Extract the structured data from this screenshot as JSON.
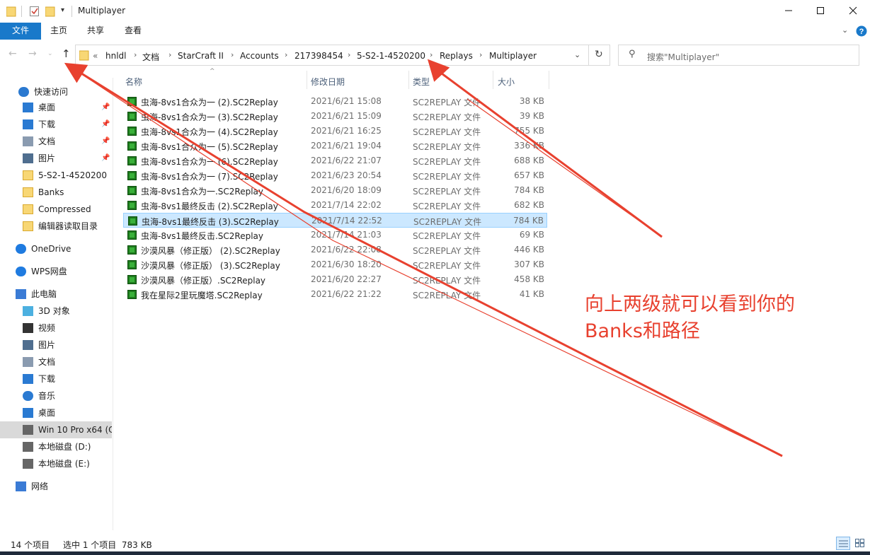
{
  "window": {
    "title": "Multiplayer"
  },
  "ribbon": {
    "tabs": [
      "文件",
      "主页",
      "共享",
      "查看"
    ]
  },
  "address": {
    "overflow": "«",
    "crumbs": [
      "hnldl",
      "文档",
      "StarCraft II",
      "Accounts",
      "217398454",
      "5-S2-1-4520200",
      "Replays",
      "Multiplayer"
    ]
  },
  "search": {
    "placeholder": "搜索\"Multiplayer\""
  },
  "nav": {
    "quick_access": "快速访问",
    "items": [
      {
        "label": "快速访问",
        "icon": "star-icon"
      },
      {
        "label": "桌面",
        "icon": "desktop-icon",
        "pinned": true
      },
      {
        "label": "下载",
        "icon": "download-icon",
        "pinned": true
      },
      {
        "label": "文档",
        "icon": "document-icon",
        "pinned": true
      },
      {
        "label": "图片",
        "icon": "picture-icon",
        "pinned": true
      },
      {
        "label": "5-S2-1-4520200",
        "icon": "folder-icon"
      },
      {
        "label": "Banks",
        "icon": "folder-icon"
      },
      {
        "label": "Compressed",
        "icon": "folder-icon"
      },
      {
        "label": "编辑器读取目录",
        "icon": "folder-icon"
      },
      {
        "label": "OneDrive",
        "icon": "cloud-icon"
      },
      {
        "label": "WPS网盘",
        "icon": "cloud-icon"
      },
      {
        "label": "此电脑",
        "icon": "computer-icon"
      },
      {
        "label": "3D 对象",
        "icon": "cube-icon"
      },
      {
        "label": "视频",
        "icon": "video-icon"
      },
      {
        "label": "图片",
        "icon": "picture-icon"
      },
      {
        "label": "文档",
        "icon": "document-icon"
      },
      {
        "label": "下载",
        "icon": "download-icon"
      },
      {
        "label": "音乐",
        "icon": "music-icon"
      },
      {
        "label": "桌面",
        "icon": "desktop-icon"
      },
      {
        "label": "Win 10 Pro x64 (C",
        "icon": "drive-icon"
      },
      {
        "label": "本地磁盘 (D:)",
        "icon": "drive-icon"
      },
      {
        "label": "本地磁盘 (E:)",
        "icon": "drive-icon"
      },
      {
        "label": "网络",
        "icon": "network-icon"
      }
    ]
  },
  "columns": {
    "name": "名称",
    "date": "修改日期",
    "type": "类型",
    "size": "大小"
  },
  "files": [
    {
      "name": "虫海-8vs1合众为一 (2).SC2Replay",
      "date": "2021/6/21 15:08",
      "type": "SC2REPLAY 文件",
      "size": "38 KB"
    },
    {
      "name": "虫海-8vs1合众为一 (3).SC2Replay",
      "date": "2021/6/21 15:09",
      "type": "SC2REPLAY 文件",
      "size": "39 KB"
    },
    {
      "name": "虫海-8vs1合众为一 (4).SC2Replay",
      "date": "2021/6/21 16:25",
      "type": "SC2REPLAY 文件",
      "size": "755 KB"
    },
    {
      "name": "虫海-8vs1合众为一 (5).SC2Replay",
      "date": "2021/6/21 19:04",
      "type": "SC2REPLAY 文件",
      "size": "336 KB"
    },
    {
      "name": "虫海-8vs1合众为一 (6).SC2Replay",
      "date": "2021/6/22 21:07",
      "type": "SC2REPLAY 文件",
      "size": "688 KB"
    },
    {
      "name": "虫海-8vs1合众为一 (7).SC2Replay",
      "date": "2021/6/23 20:54",
      "type": "SC2REPLAY 文件",
      "size": "657 KB"
    },
    {
      "name": "虫海-8vs1合众为一.SC2Replay",
      "date": "2021/6/20 18:09",
      "type": "SC2REPLAY 文件",
      "size": "784 KB"
    },
    {
      "name": "虫海-8vs1最终反击 (2).SC2Replay",
      "date": "2021/7/14 22:02",
      "type": "SC2REPLAY 文件",
      "size": "682 KB"
    },
    {
      "name": "虫海-8vs1最终反击 (3).SC2Replay",
      "date": "2021/7/14 22:52",
      "type": "SC2REPLAY 文件",
      "size": "784 KB",
      "selected": true
    },
    {
      "name": "虫海-8vs1最终反击.SC2Replay",
      "date": "2021/7/14 21:03",
      "type": "SC2REPLAY 文件",
      "size": "69 KB"
    },
    {
      "name": "沙漠风暴（修正版） (2).SC2Replay",
      "date": "2021/6/22 22:08",
      "type": "SC2REPLAY 文件",
      "size": "446 KB"
    },
    {
      "name": "沙漠风暴（修正版） (3).SC2Replay",
      "date": "2021/6/30 18:20",
      "type": "SC2REPLAY 文件",
      "size": "307 KB"
    },
    {
      "name": "沙漠风暴（修正版）.SC2Replay",
      "date": "2021/6/20 22:27",
      "type": "SC2REPLAY 文件",
      "size": "458 KB"
    },
    {
      "name": "我在星际2里玩魔塔.SC2Replay",
      "date": "2021/6/22 21:22",
      "type": "SC2REPLAY 文件",
      "size": "41 KB"
    }
  ],
  "status": {
    "count": "14 个项目",
    "selection": "选中 1 个项目  783 KB"
  },
  "annotation": {
    "line1": "向上两级就可以看到你的",
    "line2": "Banks和路径"
  },
  "colors": {
    "accent": "#1979ca",
    "annotation": "#e8412f",
    "selection": "#cce8ff"
  }
}
